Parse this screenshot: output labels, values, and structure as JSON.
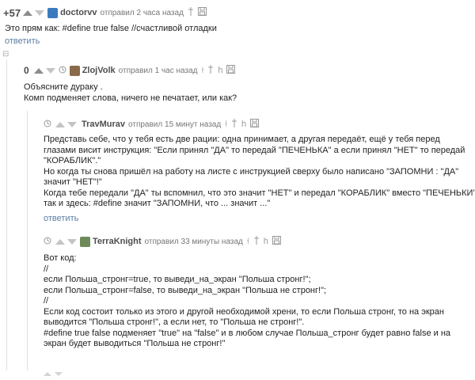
{
  "comments": [
    {
      "rating": "+57",
      "username": "doctorvv",
      "sent": "отправил 2 часа назад",
      "lines": [
        "Это прям как: #define true false //счастливой отладки"
      ],
      "reply": "ответить",
      "avatar_color": "#3a7bbf"
    },
    {
      "rating": "0",
      "username": "ZlojVolk",
      "sent": "отправил 1 час назад",
      "lines": [
        "Объясните дураку .",
        "Комп подменяет слова, ничего не печатает, или как?"
      ],
      "avatar_color": "#8a6a4a"
    },
    {
      "username": "TravMurav",
      "sent": "отправил 15 минут назад",
      "lines": [
        "Представь себе, что у тебя есть две рации: одна принимает, а другая передаёт, ещё у тебя перед",
        "глазами висит инструкция: \"Если принял \"ДА\" то передай \"ПЕЧЕНЬКА\" а если принял \"НЕТ\" то передай",
        "\"КОРАБЛИК\".\"",
        "Но когда ты снова пришёл на работу на листе с инструкцией сверху было написано \"ЗАПОМНИ : \"ДА\"",
        "значит \"НЕТ\"!\"",
        "Когда тебе передали \"ДА\" ты вспомнил, что это значит \"НЕТ\" и передал \"КОРАБЛИК\" вместо \"ПЕЧЕНЬКИ\"",
        "так и здесь: #define значит \"ЗАПОМНИ, что ... значит ...\""
      ],
      "reply": "ответить"
    },
    {
      "username": "TerraKnight",
      "sent": "отправил 33 минуты назад",
      "lines": [
        "Вот код:",
        "//",
        "если Польша_стронг=true, то выведи_на_экран \"Польша стронг!\";",
        "если Польша_стронг=false, то выведи_на_экран \"Польша не стронг!\";",
        "//",
        "Если код состоит только из этого и другой необходимой хрени, то если Польша стронг, то на экран",
        "выводится \"Польша стронг!\", а если нет, то \"Польша не стронг!\".",
        "#define true false подменяет \"true\" на \"false\" и в любом случае Польша_стронг будет равно false и на",
        "экран будет выводиться \"Польша не стронг!\""
      ],
      "avatar_color": "#6e8a5a"
    }
  ],
  "collapse_symbol": "⊟",
  "colors": {
    "link": "#5b7ea3",
    "vote_arrow": "#c4c4c4",
    "vote_arrow_dark": "#888888"
  }
}
